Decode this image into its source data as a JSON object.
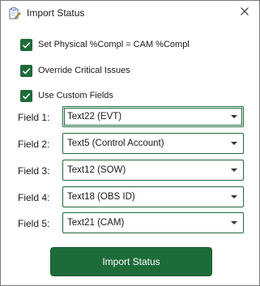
{
  "window": {
    "title": "Import Status",
    "app_icon": "clipboard-pen-icon",
    "close_icon": "close-icon"
  },
  "options": [
    {
      "label": "Set Physical %Compl = CAM %Compl",
      "checked": true
    },
    {
      "label": "Override Critical Issues",
      "checked": true
    },
    {
      "label": "Use Custom Fields",
      "checked": true
    }
  ],
  "fields": [
    {
      "label": "Field 1:",
      "value": "Text22 (EVT)"
    },
    {
      "label": "Field 2:",
      "value": "Text5 (Control Account)"
    },
    {
      "label": "Field 3:",
      "value": "Text12 (SOW)"
    },
    {
      "label": "Field 4:",
      "value": "Text18 (OBS ID)"
    },
    {
      "label": "Field 5:",
      "value": "Text21 (CAM)"
    }
  ],
  "action": {
    "label": "Import Status"
  },
  "colors": {
    "accent": "#1e6b3a",
    "window_border": "#7a7a7a"
  }
}
